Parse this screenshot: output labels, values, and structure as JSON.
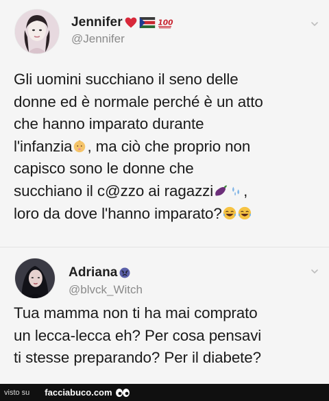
{
  "tweets": [
    {
      "display_name": "Jennifer",
      "handle": "@Jennifer",
      "name_emojis": [
        "heart-icon",
        "flag-icon",
        "100-icon"
      ],
      "lines": [
        "Gli uomini succhiano il seno delle",
        "donne ed è normale perché è un atto",
        "che hanno imparato durante",
        "l'infanzia",
        ", ma ciò che proprio non",
        "capisco sono le donne che",
        "succhiano il c@zzo ai ragazzi",
        ",",
        "loro da dove l'hanno imparato?"
      ]
    },
    {
      "display_name": "Adriana",
      "handle": "@blvck_Witch",
      "name_emojis": [
        "angry-face-icon"
      ],
      "lines": [
        "Tua mamma non ti ha mai comprato",
        "un lecca-lecca eh? Per cosa pensavi",
        "ti stesse preparando? Per il diabete?"
      ]
    }
  ],
  "footer": {
    "visto_su": "visto su",
    "site": "facciabuco.com"
  },
  "colors": {
    "background": "#f4f4f4",
    "text": "#1a1a1a",
    "handle": "#8a8a8a",
    "footer_bg": "#101010"
  }
}
